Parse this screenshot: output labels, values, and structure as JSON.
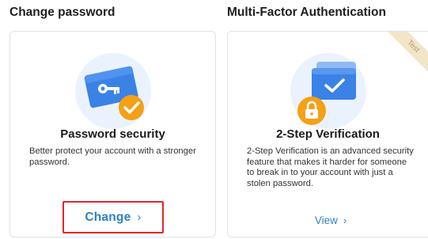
{
  "sections": {
    "change_password": {
      "heading": "Change password",
      "card_title": "Password security",
      "description": "Better protect your account with a stronger password.",
      "action_label": "Change",
      "action_chevron": "›",
      "icon": "key-card-checkmark-icon"
    },
    "mfa": {
      "heading": "Multi-Factor Authentication",
      "badge": "Test",
      "card_title": "2-Step Verification",
      "description": "2-Step Verification is an advanced security feature that makes it harder for someone to break in to your account with just a stolen password.",
      "action_label": "View",
      "action_chevron": "›",
      "icon": "stacked-windows-lock-icon"
    }
  },
  "colors": {
    "accent_blue": "#2f7fc4",
    "highlight_red": "#e5262b",
    "card_blue": "#3b82e6",
    "check_orange": "#f5a016",
    "ribbon_bg": "#f2e5c8"
  }
}
